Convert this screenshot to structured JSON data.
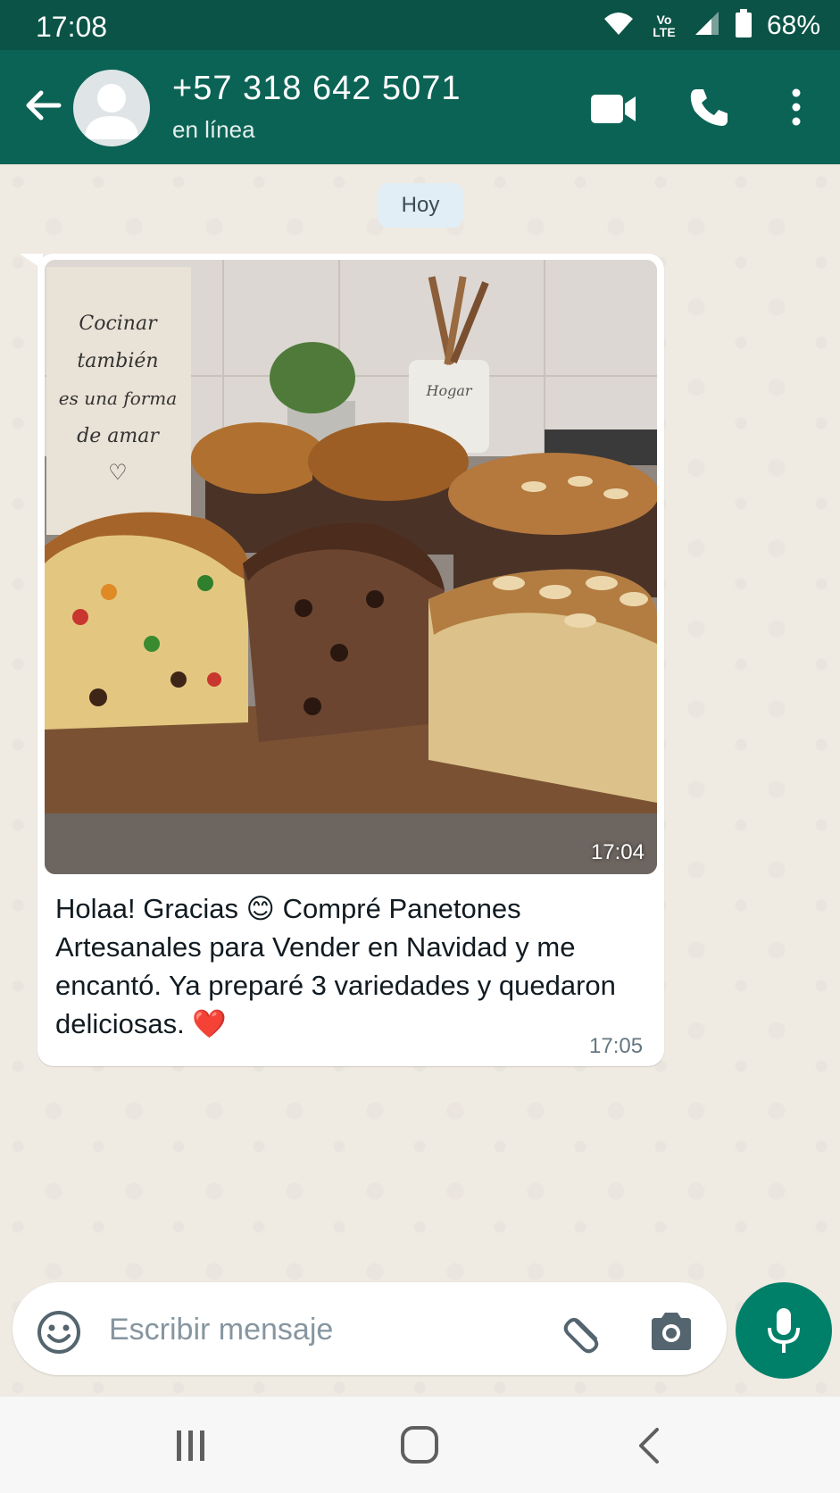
{
  "status_bar": {
    "time": "17:08",
    "network": "Vo LTE",
    "battery": "68%",
    "icons": [
      "wifi-icon",
      "volte-icon",
      "signal-icon",
      "battery-icon"
    ]
  },
  "header": {
    "contact": "+57 318 642 5071",
    "status": "en línea",
    "icons": [
      "back-arrow-icon",
      "avatar-placeholder-icon",
      "video-call-icon",
      "phone-icon",
      "more-vert-icon"
    ]
  },
  "chat": {
    "date_chip": "Hoy",
    "message": {
      "image_time": "17:04",
      "image_sign_text": "Cocinar también es una forma de amar",
      "image_jar_text": "Hogar",
      "text": "Holaa! Gracias 😊 Compré Panetones Artesanales para Vender en Navidad y me encantó. Ya preparé 3 variedades y quedaron deliciosas. ❤️",
      "time": "17:05"
    }
  },
  "composer": {
    "placeholder": "Escribir mensaje",
    "icons": [
      "emoji-icon",
      "attach-icon",
      "camera-icon",
      "mic-icon"
    ]
  },
  "colors": {
    "header_bg": "#0b6355",
    "status_bg": "#0b5346",
    "accent": "#008069",
    "chat_bg": "#efeae2"
  }
}
